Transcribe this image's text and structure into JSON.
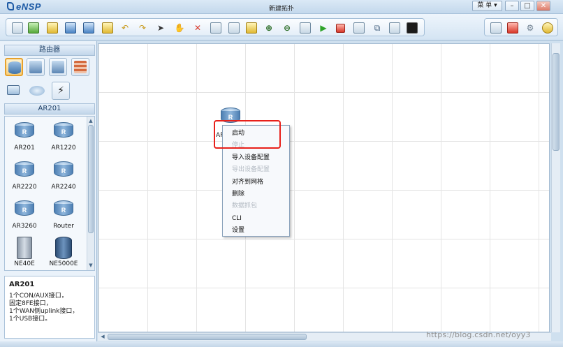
{
  "app": {
    "logo_text": "eNSP",
    "window_title": "新建拓扑",
    "menu_label": "菜 单",
    "window_buttons": [
      "–",
      "□",
      "✕"
    ]
  },
  "toolbar": {
    "left_icons": [
      "new-topology-icon",
      "new-exam-icon",
      "open-icon",
      "save-icon",
      "save-as-icon",
      "print-icon",
      "undo-icon",
      "redo-icon",
      "pointer-icon",
      "hand-icon",
      "delete-icon",
      "delete-link-icon",
      "text-icon",
      "rectangle-icon",
      "zoom-in-icon",
      "zoom-out-icon",
      "fit-icon",
      "start-icon",
      "stop-icon",
      "capture-icon",
      "topology-icon",
      "grid-icon",
      "terminal-icon"
    ],
    "right_icons": [
      "comment-icon",
      "huawei-icon",
      "settings-icon",
      "help-icon"
    ]
  },
  "left_panel": {
    "category_title": "路由器",
    "categories": [
      "routers-category-icon",
      "switches-category-icon",
      "wlan-category-icon",
      "firewall-category-icon",
      "pc-category-icon",
      "cloud-category-icon",
      "connection-category-icon"
    ],
    "subcategory_title": "AR201",
    "devices": [
      {
        "name": "AR201",
        "icon": "router-icon"
      },
      {
        "name": "AR1220",
        "icon": "router-icon"
      },
      {
        "name": "AR2220",
        "icon": "router-icon"
      },
      {
        "name": "AR2240",
        "icon": "router-icon"
      },
      {
        "name": "AR3260",
        "icon": "router-icon"
      },
      {
        "name": "Router",
        "icon": "router-icon"
      },
      {
        "name": "NE40E",
        "icon": "chassis-icon"
      },
      {
        "name": "NE5000E",
        "icon": "chassis-icon"
      }
    ],
    "description": {
      "title": "AR201",
      "lines": [
        "1个CON/AUX接口，",
        "固定8FE接口，",
        "1个WAN侧uplink接口，",
        "1个USB接口。"
      ]
    }
  },
  "canvas": {
    "node_label": "AR",
    "context_menu": [
      {
        "label": "启动",
        "enabled": true
      },
      {
        "label": "停止",
        "enabled": false
      },
      {
        "label": "导入设备配置",
        "enabled": true
      },
      {
        "label": "导出设备配置",
        "enabled": false
      },
      {
        "label": "对齐到网格",
        "enabled": true
      },
      {
        "label": "删除",
        "enabled": true
      },
      {
        "label": "数据抓包",
        "enabled": false
      },
      {
        "label": "CLI",
        "enabled": true
      },
      {
        "label": "设置",
        "enabled": true
      }
    ]
  },
  "watermark": "https://blog.csdn.net/oyy3",
  "colors": {
    "highlight": "#e8201a",
    "accent": "#1d5aa5"
  }
}
